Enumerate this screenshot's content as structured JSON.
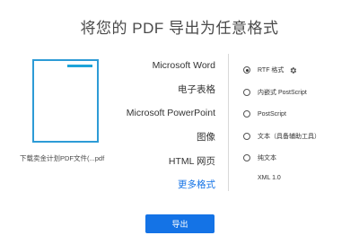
{
  "title": "将您的 PDF 导出为任意格式",
  "file": {
    "name": "下载卖金计划PDF文件(...pdf"
  },
  "categories": [
    {
      "label": "Microsoft Word",
      "active": false
    },
    {
      "label": "电子表格",
      "active": false
    },
    {
      "label": "Microsoft PowerPoint",
      "active": false
    },
    {
      "label": "图像",
      "active": false
    },
    {
      "label": "HTML 网页",
      "active": false
    },
    {
      "label": "更多格式",
      "active": true
    }
  ],
  "options": [
    {
      "label": "RTF 格式",
      "checked": true,
      "has_settings": true
    },
    {
      "label": "内嵌式 PostScript",
      "checked": false
    },
    {
      "label": "PostScript",
      "checked": false
    },
    {
      "label": "文本（具备辅助工具）",
      "checked": false
    },
    {
      "label": "纯文本",
      "checked": false
    }
  ],
  "sub_option": "XML 1.0",
  "export_button": "导出",
  "colors": {
    "accent": "#1473e6",
    "thumbnail_border": "#2d9bd6"
  },
  "icons": {
    "settings": "gear-icon"
  }
}
